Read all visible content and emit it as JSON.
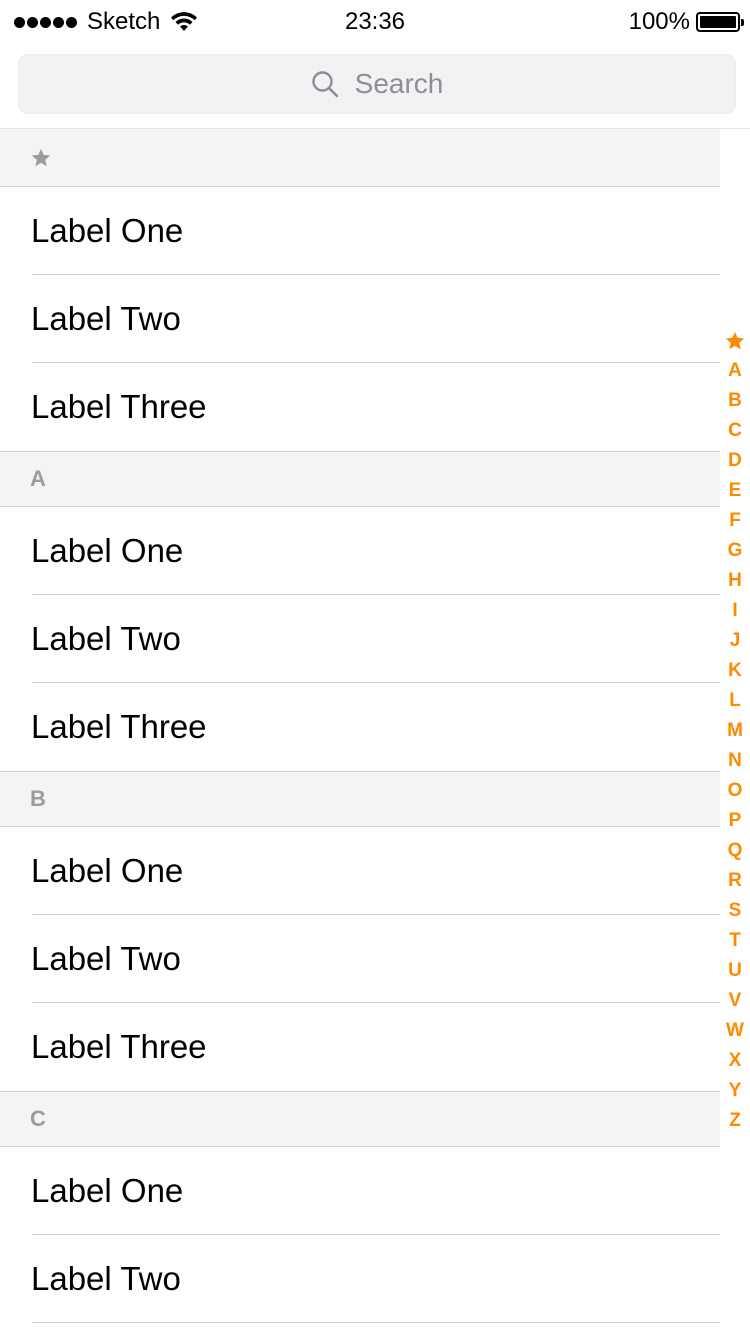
{
  "status_bar": {
    "carrier": "Sketch",
    "time": "23:36",
    "battery_percent": "100%"
  },
  "search": {
    "placeholder": "Search",
    "icon": "search-icon"
  },
  "colors": {
    "accent": "#ff8a00",
    "section_bg": "#f4f4f5",
    "header_text": "#9b9ba0"
  },
  "sections": [
    {
      "title": "★",
      "icon": "star-icon",
      "rows": [
        "Label One",
        "Label Two",
        "Label Three"
      ]
    },
    {
      "title": "A",
      "rows": [
        "Label One",
        "Label Two",
        "Label Three"
      ]
    },
    {
      "title": "B",
      "rows": [
        "Label One",
        "Label Two",
        "Label Three"
      ]
    },
    {
      "title": "C",
      "rows": [
        "Label One",
        "Label Two"
      ]
    }
  ],
  "index": [
    "★",
    "A",
    "B",
    "C",
    "D",
    "E",
    "F",
    "G",
    "H",
    "I",
    "J",
    "K",
    "L",
    "M",
    "N",
    "O",
    "P",
    "Q",
    "R",
    "S",
    "T",
    "U",
    "V",
    "W",
    "X",
    "Y",
    "Z"
  ]
}
